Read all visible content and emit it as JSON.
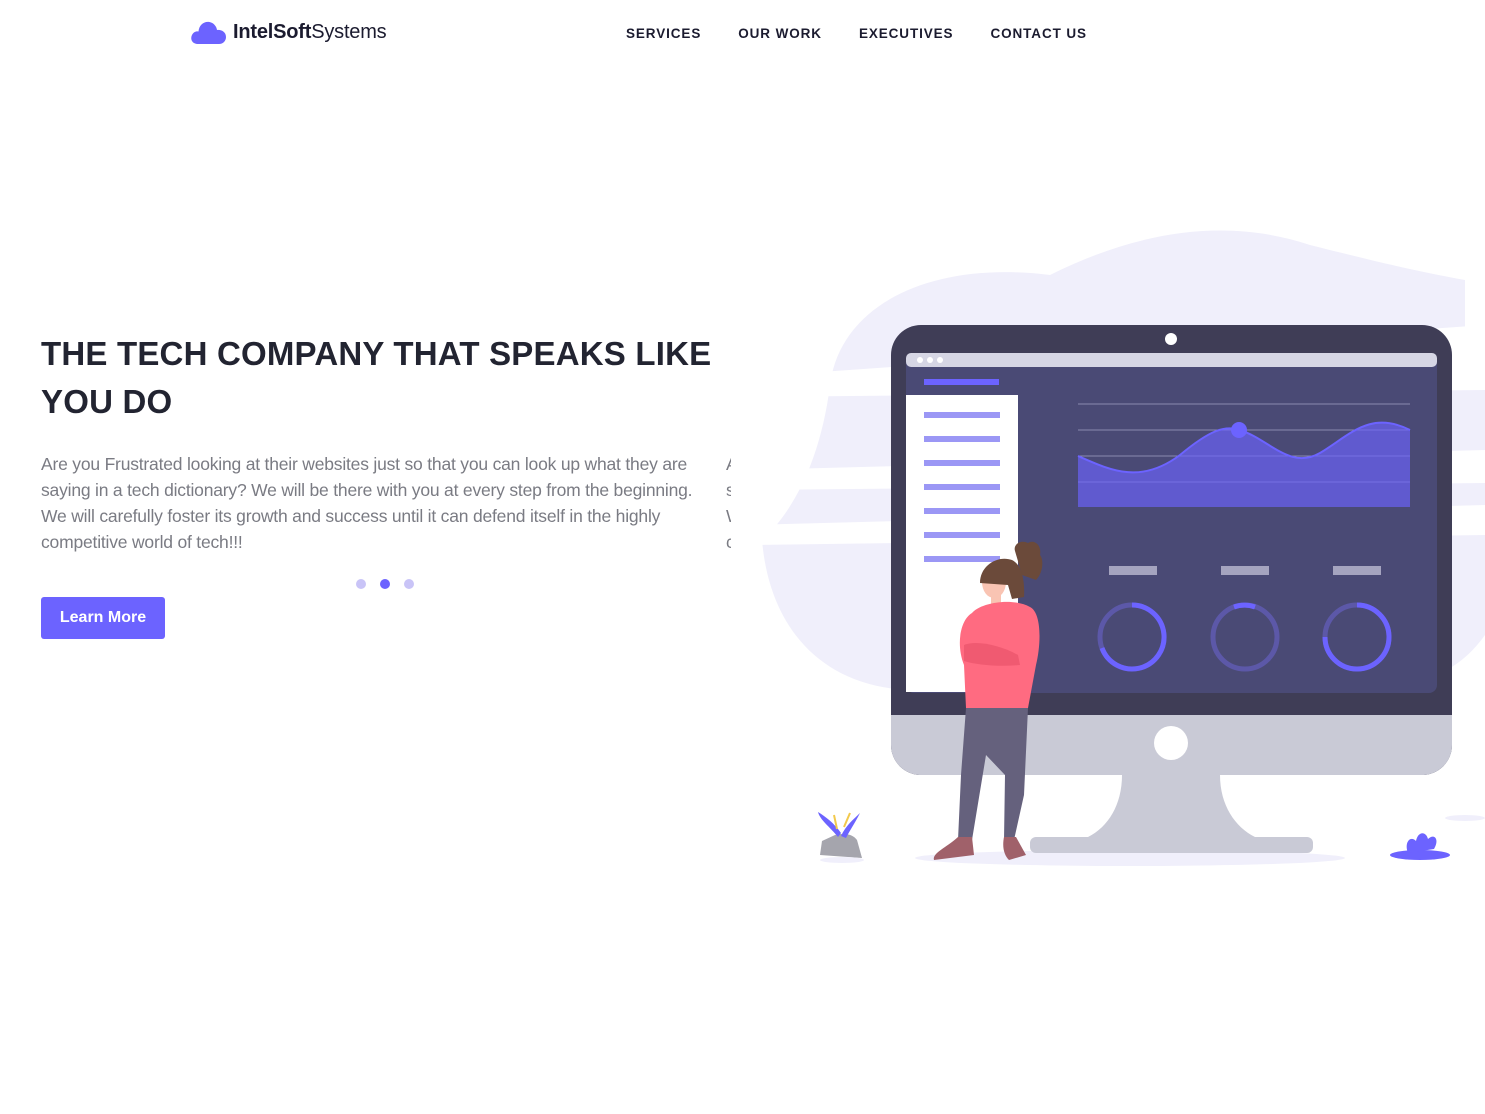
{
  "header": {
    "brand_bold": "IntelSoft",
    "brand_regular": "Systems",
    "logo_icon": "cloud-icon",
    "nav": [
      {
        "label": "SERVICES"
      },
      {
        "label": "OUR WORK"
      },
      {
        "label": "EXECUTIVES"
      },
      {
        "label": "CONTACT US"
      }
    ]
  },
  "hero": {
    "title": "THE TECH COMPANY THAT SPEAKS LIKE YOU DO",
    "slides": [
      {
        "text": "Are you Frustrated looking at their websites just so that you can look up what they are saying in a tech dictionary? We will be there with you at every step from the beginning. We will carefully foster its growth and success until it can defend itself in the highly competitive world of tech!!!"
      }
    ],
    "slide_count": 3,
    "active_slide": 2,
    "cta_label": "Learn More"
  },
  "illustration": {
    "subject": "person standing beside analytics dashboard monitor"
  },
  "colors": {
    "accent": "#6c63ff",
    "heading": "#222431",
    "body_text": "#7a7b83",
    "dot_inactive": "#c9c4f7",
    "monitor_frame": "#3f3d56",
    "screen": "#4a4a75",
    "blob": "#f0effb"
  }
}
